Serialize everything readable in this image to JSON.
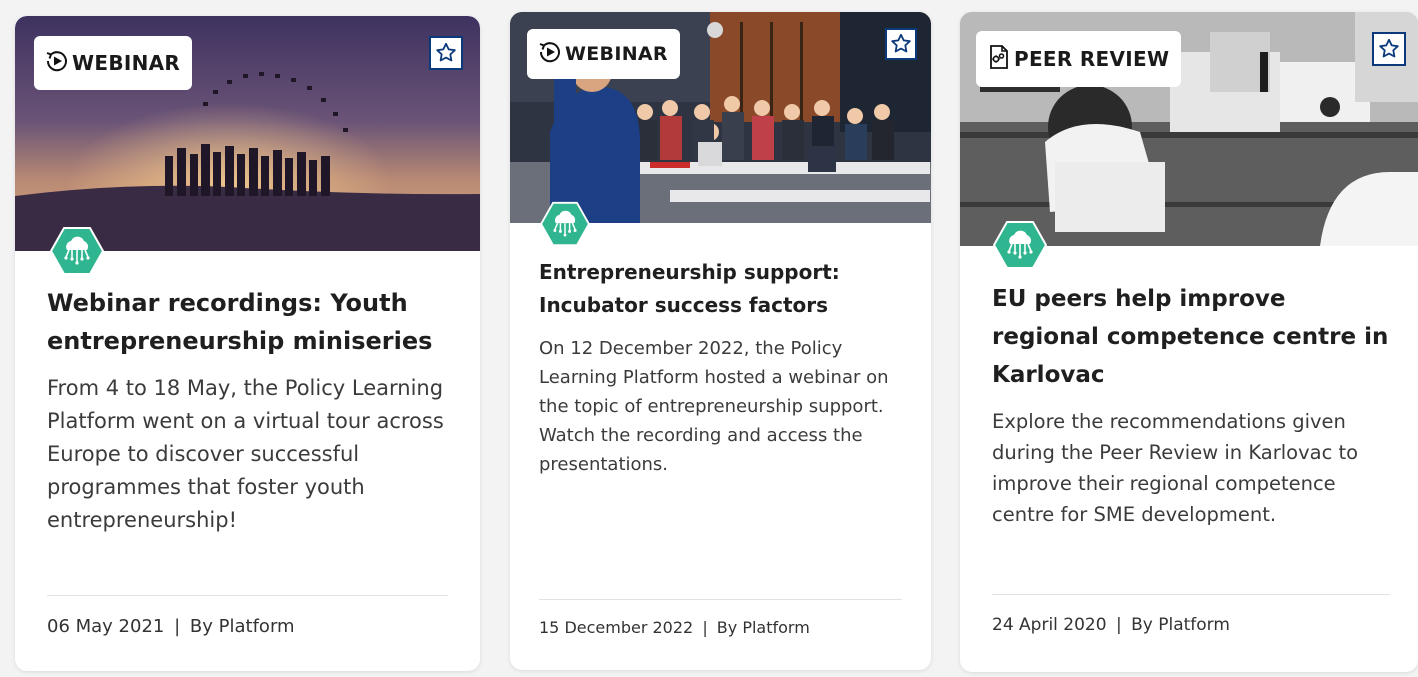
{
  "cards": [
    {
      "type": "WEBINAR",
      "type_icon": "play-circle-icon",
      "title": "Webinar recordings: Youth entrepreneurship miniseries",
      "description": "From 4 to 18 May, the Policy Learning Platform went on a virtual tour across Europe to discover successful programmes that foster youth entrepreneurship!",
      "date": "06 May 2021",
      "separator": "|",
      "author": "By Platform",
      "topic_icon": "cloud-network-hexagon-icon"
    },
    {
      "type": "WEBINAR",
      "type_icon": "play-circle-icon",
      "title": "Entrepreneurship support: Incubator success factors",
      "description": "On 12 December 2022, the Policy Learning Platform hosted a webinar on the topic of entrepreneurship support. Watch the recording and access the presentations.",
      "date": "15 December 2022",
      "separator": "|",
      "author": "By Platform",
      "topic_icon": "cloud-network-hexagon-icon"
    },
    {
      "type": "PEER REVIEW",
      "type_icon": "document-gear-icon",
      "title": "EU peers help improve regional competence centre in Karlovac",
      "description": "Explore the recommendations given during the Peer Review in Karlovac to improve their regional competence centre for SME development.",
      "date": "24 April 2020",
      "separator": "|",
      "author": "By Platform",
      "topic_icon": "cloud-network-hexagon-icon"
    }
  ],
  "colors": {
    "star_border": "#0b3a7a",
    "hex_green": "#2fb58f",
    "divider": "#e2e2e2"
  }
}
